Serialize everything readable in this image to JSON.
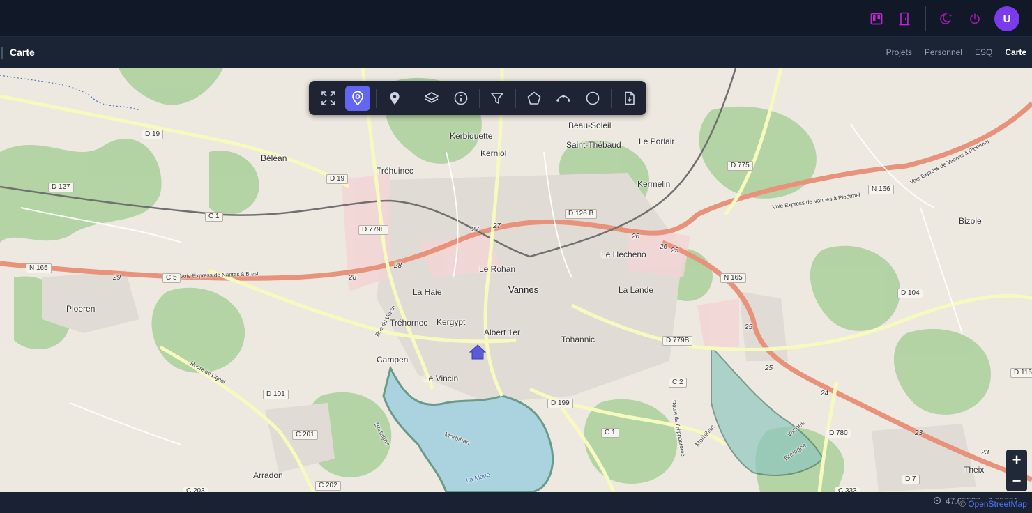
{
  "header": {
    "avatar_initial": "U",
    "icons": [
      "kanban-icon",
      "door-icon",
      "theme-moon-icon",
      "power-icon"
    ],
    "brand_color": "#7c3aed"
  },
  "subheader": {
    "title": "Carte",
    "breadcrumbs": [
      {
        "label": "Projets",
        "active": false
      },
      {
        "label": "Personnel",
        "active": false
      },
      {
        "label": "ESQ",
        "active": false
      },
      {
        "label": "Carte",
        "active": true
      }
    ]
  },
  "toolbar": {
    "tools": [
      {
        "icon": "fullscreen-icon",
        "active": false
      },
      {
        "icon": "location-pin-icon",
        "active": true
      },
      {
        "icon": "marker-icon",
        "active": false
      },
      {
        "icon": "layers-icon",
        "active": false
      },
      {
        "icon": "info-icon",
        "active": false
      },
      {
        "icon": "filter-icon",
        "active": false
      },
      {
        "icon": "polygon-icon",
        "active": false
      },
      {
        "icon": "polyline-icon",
        "active": false
      },
      {
        "icon": "circle-icon",
        "active": false
      },
      {
        "icon": "export-file-icon",
        "active": false
      }
    ],
    "accent_color": "#6366f1"
  },
  "map": {
    "places": [
      "Kerbiquette",
      "Kerniol",
      "Beau-Soleil",
      "Saint-Thébaud",
      "Le Porlair",
      "Béléan",
      "Tréhuinec",
      "Kermelin",
      "Bizole",
      "Le Rohan",
      "Vannes",
      "Le Hecheno",
      "La Lande",
      "La Haie",
      "Tréhornec",
      "Kergypt",
      "Albert 1er",
      "Tohannic",
      "Ploeren",
      "Campen",
      "Le Vincin",
      "Arradon",
      "Theix"
    ],
    "roads": [
      "D 19",
      "D 19",
      "D 127",
      "C 1",
      "D 779E",
      "D 126 B",
      "D 775",
      "N 166",
      "N 165",
      "C 5",
      "N 165",
      "D 104",
      "D 779B",
      "D 101",
      "C 2",
      "D 199",
      "C 201",
      "C 1",
      "D 780",
      "D 116",
      "C 202",
      "D 7",
      "C 203",
      "C 333"
    ],
    "road_names": [
      "Voie Express de Nantes à Brest",
      "Voie Express de Vannes à Ploërmel",
      "Voie Express de Vannes à Ploërmel",
      "Route de Lignol",
      "Rue du Vincin",
      "Route de l'Hippodrome",
      "Bretagne",
      "Morbihan",
      "La Marle",
      "Morbihan",
      "Bretagne",
      "Vannes"
    ],
    "junctions": [
      "29",
      "28",
      "28",
      "27",
      "27",
      "26",
      "26",
      "25",
      "25",
      "25",
      "24",
      "23",
      "23"
    ]
  },
  "zoom": {
    "in": "+",
    "out": "−"
  },
  "status": {
    "coords": "47.65537, -2.75781",
    "attribution_prefix": "©",
    "attribution_link": "OpenStreetMap"
  }
}
